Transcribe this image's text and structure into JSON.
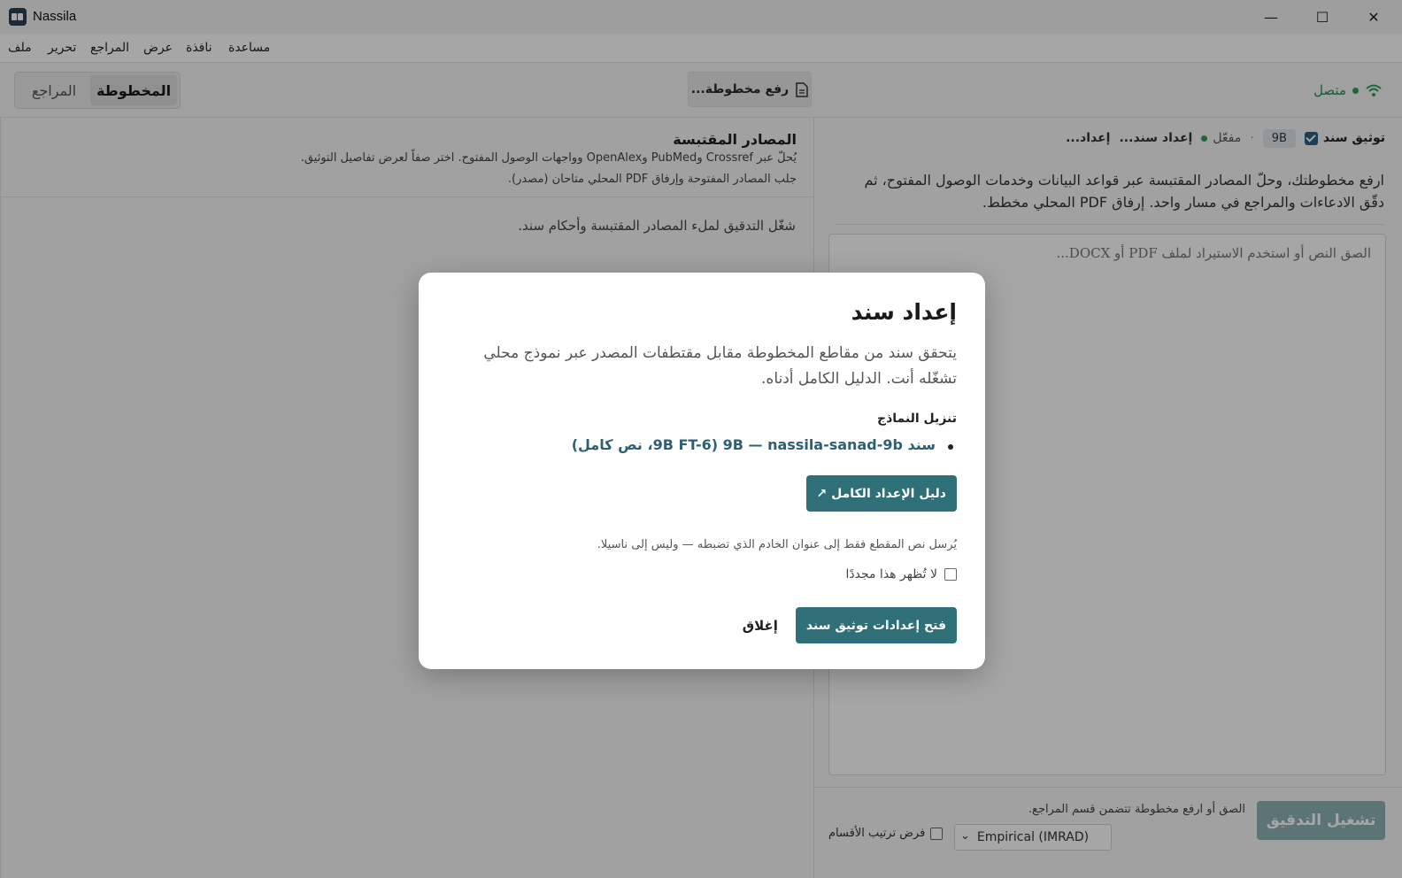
{
  "window": {
    "title": "Nassila",
    "minimize": "—",
    "maximize": "☐",
    "close": "✕"
  },
  "menu": [
    "ملف",
    "تحرير",
    "المراجع",
    "عرض",
    "نافذة",
    "مساعدة"
  ],
  "topbar": {
    "status": "متصل",
    "upload": "رفع مخطوطة...",
    "tabs": [
      "المخطوطة",
      "المراجع"
    ]
  },
  "sources": {
    "title": "المصادر المقتبسة",
    "line1": "يُحلّ عبر Crossref وPubMed وOpenAlex وواجهات الوصول المفتوح. اختر صفاً لعرض تفاصيل التوثيق.",
    "line2": "جلب المصادر المفتوحة وإرفاق PDF المحلي متاحان (مصدر).",
    "empty": "شغّل التدقيق لملء المصادر المقتبسة وأحكام سند."
  },
  "manuscript": {
    "toolbar": {
      "setup": "إعداد...",
      "setup_sanad": "إعداد سند...",
      "enabled": "مفعّل",
      "model_badge": "9B",
      "separator": "·",
      "verify_sanad": "توثيق سند"
    },
    "intro": "ارفع مخطوطتك، وحلّ المصادر المقتبسة عبر قواعد البيانات وخدمات الوصول المفتوح، ثم دقّق الادعاءات والمراجع في مسار واحد. إرفاق PDF المحلي مخطط.",
    "placeholder": "الصق النص أو استخدم الاستيراد لملف PDF أو DOCX...",
    "run": "تشغيل التدقيق",
    "hint": "الصق أو ارفع مخطوطة تتضمن قسم المراجع.",
    "select_value": "Empirical (IMRAD)",
    "order_label": "فرض ترتيب الأقسام"
  },
  "modal": {
    "title": "إعداد سند",
    "description": "يتحقق سند من مقاطع المخطوطة مقابل مقتطفات المصدر عبر نموذج محلي تشغّله أنت. الدليل الكامل أدناه.",
    "subtitle": "تنزيل النماذج",
    "models": [
      "سند 9B — nassila-sanad-9b (9B FT-6، نص كامل)"
    ],
    "guide_button": "دليل الإعداد الكامل ↗",
    "note": "يُرسل نص المقطع فقط إلى عنوان الخادم الذي تضبطه — وليس إلى ناسيلا.",
    "dont_show": "لا تُظهر هذا مجددًا",
    "open_settings": "فتح إعدادات توثيق سند",
    "close": "إغلاق"
  },
  "colors": {
    "accent": "#2f6f78",
    "online": "#2e9b5a",
    "run_disabled": "#8fb2b5"
  },
  "icons": {
    "status": "wifi-icon",
    "upload": "document-icon",
    "window_close": "close-icon"
  }
}
